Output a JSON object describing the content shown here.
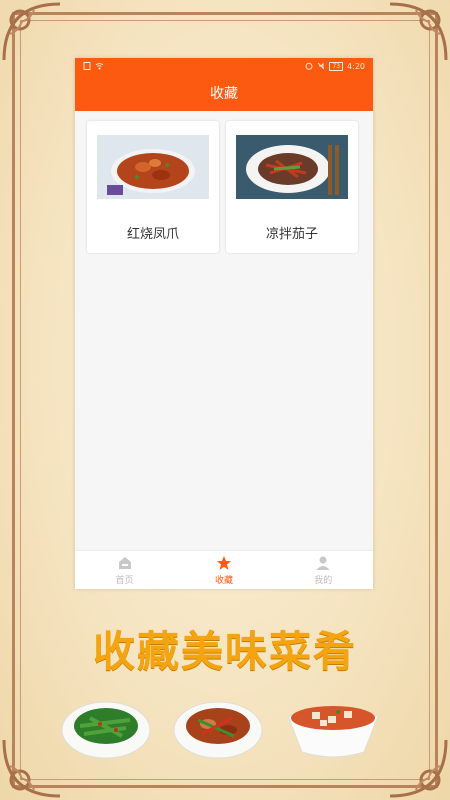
{
  "status_bar": {
    "time": "4:20",
    "battery": "73",
    "left_icons": [
      "sim-icon",
      "wifi-icon"
    ],
    "right_icons": [
      "alarm-icon",
      "mute-icon",
      "battery-icon"
    ]
  },
  "header": {
    "title": "收藏"
  },
  "favorites": [
    {
      "label": "红烧凤爪",
      "image": "braised-chicken-feet"
    },
    {
      "label": "凉拌茄子",
      "image": "eggplant-salad"
    }
  ],
  "tabbar": {
    "items": [
      {
        "label": "首页",
        "icon": "home-icon",
        "active": false
      },
      {
        "label": "收藏",
        "icon": "star-icon",
        "active": true
      },
      {
        "label": "我的",
        "icon": "user-icon",
        "active": false
      }
    ]
  },
  "slogan": "收藏美味菜肴",
  "colors": {
    "accent": "#fb5a10",
    "slogan": "#f3a40e",
    "frame": "#b9835c"
  }
}
